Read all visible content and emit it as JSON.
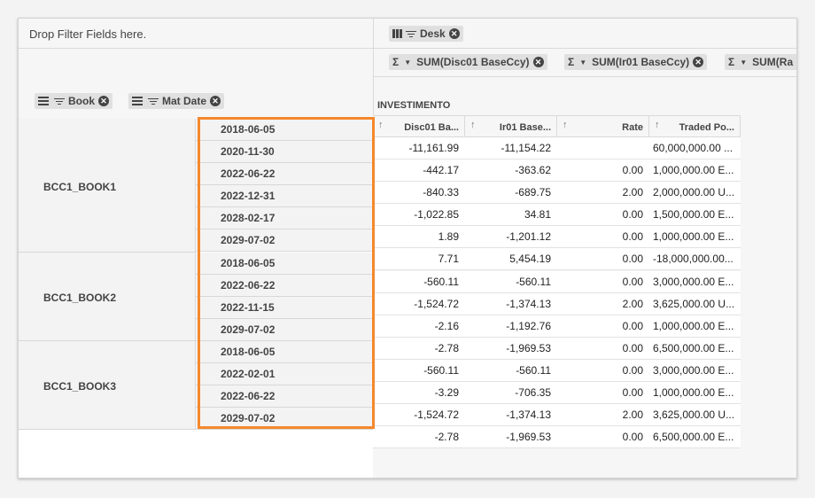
{
  "filter_zone": {
    "placeholder": "Drop Filter Fields here."
  },
  "row_fields": [
    {
      "label": "Book"
    },
    {
      "label": "Mat Date"
    }
  ],
  "column_field": {
    "label": "Desk"
  },
  "measures": [
    {
      "label": "SUM(Disc01 BaseCcy)"
    },
    {
      "label": "SUM(Ir01 BaseCcy)"
    },
    {
      "label": "SUM(Ra"
    }
  ],
  "column_group": "INVESTIMENTO",
  "columns": [
    {
      "label": "Disc01 Ba..."
    },
    {
      "label": "Ir01 Base..."
    },
    {
      "label": "Rate"
    },
    {
      "label": "Traded Po..."
    }
  ],
  "books": [
    {
      "name": "BCC1_BOOK1"
    },
    {
      "name": "BCC1_BOOK2"
    },
    {
      "name": "BCC1_BOOK3"
    }
  ],
  "rows": [
    {
      "date": "2018-06-05",
      "disc01": "-11,161.99",
      "ir01": "-11,154.22",
      "rate": "",
      "traded": "60,000,000.00 ..."
    },
    {
      "date": "2020-11-30",
      "disc01": "-442.17",
      "ir01": "-363.62",
      "rate": "0.00",
      "traded": "1,000,000.00 E..."
    },
    {
      "date": "2022-06-22",
      "disc01": "-840.33",
      "ir01": "-689.75",
      "rate": "2.00",
      "traded": "2,000,000.00 U..."
    },
    {
      "date": "2022-12-31",
      "disc01": "-1,022.85",
      "ir01": "34.81",
      "rate": "0.00",
      "traded": "1,500,000.00 E..."
    },
    {
      "date": "2028-02-17",
      "disc01": "1.89",
      "ir01": "-1,201.12",
      "rate": "0.00",
      "traded": "1,000,000.00 E..."
    },
    {
      "date": "2029-07-02",
      "disc01": "7.71",
      "ir01": "5,454.19",
      "rate": "0.00",
      "traded": "-18,000,000.00..."
    },
    {
      "date": "2018-06-05",
      "disc01": "-560.11",
      "ir01": "-560.11",
      "rate": "0.00",
      "traded": "3,000,000.00 E..."
    },
    {
      "date": "2022-06-22",
      "disc01": "-1,524.72",
      "ir01": "-1,374.13",
      "rate": "2.00",
      "traded": "3,625,000.00 U..."
    },
    {
      "date": "2022-11-15",
      "disc01": "-2.16",
      "ir01": "-1,192.76",
      "rate": "0.00",
      "traded": "1,000,000.00 E..."
    },
    {
      "date": "2029-07-02",
      "disc01": "-2.78",
      "ir01": "-1,969.53",
      "rate": "0.00",
      "traded": "6,500,000.00 E..."
    },
    {
      "date": "2018-06-05",
      "disc01": "-560.11",
      "ir01": "-560.11",
      "rate": "0.00",
      "traded": "3,000,000.00 E..."
    },
    {
      "date": "2022-02-01",
      "disc01": "-3.29",
      "ir01": "-706.35",
      "rate": "0.00",
      "traded": "1,000,000.00 E..."
    },
    {
      "date": "2022-06-22",
      "disc01": "-1,524.72",
      "ir01": "-1,374.13",
      "rate": "2.00",
      "traded": "3,625,000.00 U..."
    },
    {
      "date": "2029-07-02",
      "disc01": "-2.78",
      "ir01": "-1,969.53",
      "rate": "0.00",
      "traded": "6,500,000.00 E..."
    }
  ],
  "colors": {
    "highlight": "#f5882d",
    "chip": "#e0e0e0"
  }
}
